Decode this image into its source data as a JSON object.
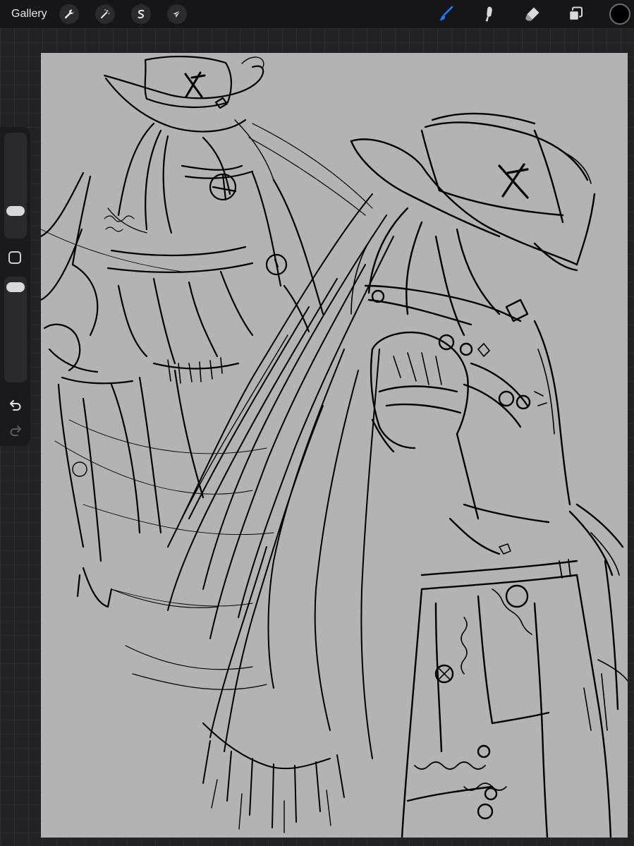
{
  "toolbar": {
    "gallery_label": "Gallery",
    "left_tools": [
      {
        "name": "actions",
        "icon": "wrench-icon"
      },
      {
        "name": "adjustments",
        "icon": "magic-wand-icon"
      },
      {
        "name": "selection",
        "icon": "selection-s-icon"
      },
      {
        "name": "transform",
        "icon": "arrow-cursor-icon"
      }
    ],
    "right_tools": [
      {
        "name": "brush",
        "icon": "brush-icon",
        "active": true
      },
      {
        "name": "smudge",
        "icon": "smudge-icon",
        "active": false
      },
      {
        "name": "eraser",
        "icon": "eraser-icon",
        "active": false
      },
      {
        "name": "layers",
        "icon": "layers-icon",
        "active": false
      }
    ],
    "current_color": "#000000",
    "active_color": "#1a7cff"
  },
  "sidebar": {
    "brush_size": 0.2,
    "brush_opacity": 1.0,
    "modify_button_icon": "square-icon",
    "undo_icon": "undo-icon",
    "redo_icon": "redo-icon"
  },
  "canvas": {
    "background": "#b3b3b3",
    "content": "sketch-drawing"
  }
}
